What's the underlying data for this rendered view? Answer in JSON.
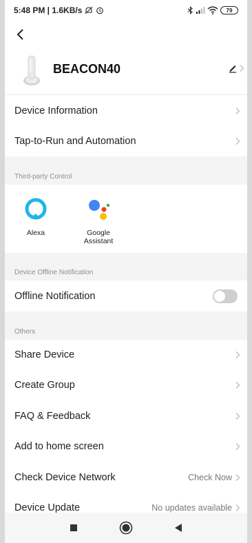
{
  "status_bar": {
    "time_info": "5:48 PM | 1.6KB/s",
    "battery": "79"
  },
  "device": {
    "name": "BEACON40"
  },
  "rows_top": [
    {
      "label": "Device Information"
    },
    {
      "label": "Tap-to-Run and Automation"
    }
  ],
  "sections": {
    "third_party": "Third-party Control",
    "offline": "Device Offline Notification",
    "others": "Others"
  },
  "third_party_items": [
    {
      "label": "Alexa"
    },
    {
      "label_line1": "Google",
      "label_line2": "Assistant"
    }
  ],
  "offline_row": {
    "label": "Offline Notification",
    "enabled": false
  },
  "others_rows": [
    {
      "label": "Share Device",
      "value": ""
    },
    {
      "label": "Create Group",
      "value": ""
    },
    {
      "label": "FAQ & Feedback",
      "value": ""
    },
    {
      "label": "Add to home screen",
      "value": ""
    },
    {
      "label": "Check Device Network",
      "value": "Check Now"
    },
    {
      "label": "Device Update",
      "value": "No updates available"
    }
  ],
  "colors": {
    "alexa": "#1fb6e8",
    "google_blue": "#4285f4",
    "google_red": "#ea4335",
    "google_yellow": "#fbbc05",
    "google_green": "#34a853"
  }
}
